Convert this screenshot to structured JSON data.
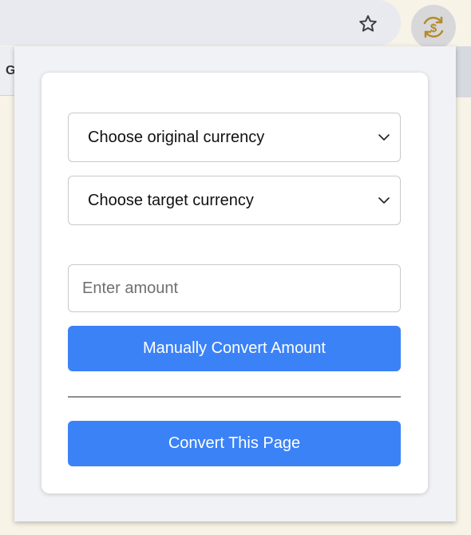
{
  "browser": {
    "behind_tab_text": "G",
    "icons": {
      "bookmark": "star-outline-icon",
      "extension": "currency-exchange-icon"
    },
    "accent_extension": "#b38b2b"
  },
  "popup": {
    "original_currency_select": {
      "label": "Choose original currency"
    },
    "target_currency_select": {
      "label": "Choose target currency"
    },
    "amount_input": {
      "placeholder": "Enter amount",
      "value": ""
    },
    "manual_convert_button": {
      "label": "Manually Convert Amount"
    },
    "convert_page_button": {
      "label": "Convert This Page"
    },
    "colors": {
      "button_bg": "#3b82f6",
      "button_text": "#ffffff"
    }
  }
}
